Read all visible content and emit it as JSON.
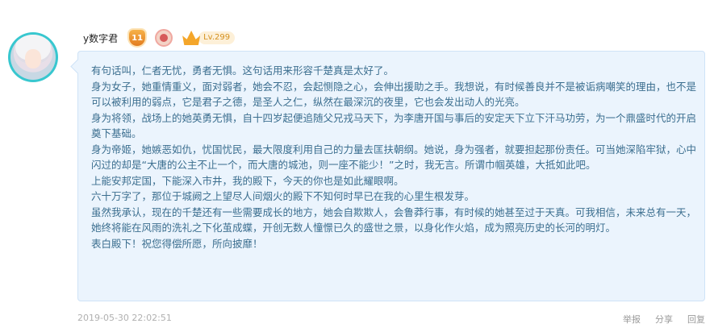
{
  "comment": {
    "username": "y数字君",
    "badges": {
      "shield_label": "11",
      "level": "Lv.299"
    },
    "paragraphs": [
      "有句话叫，仁者无忧，勇者无惧。这句话用来形容千楚真是太好了。",
      "身为女子，她重情重义，面对弱者，她会不忍，会起恻隐之心，会伸出援助之手。我想说，有时候善良并不是被诟病嘲笑的理由，也不是可以被利用的弱点，它是君子之德，是圣人之仁，纵然在最深沉的夜里，它也会发出动人的光亮。",
      "身为将领，战场上的她英勇无惧，自十四岁起便追随父兄戎马天下，为李唐开国与事后的安定天下立下汗马功劳，为一个鼎盛时代的开启奠下基础。",
      "身为帝姬，她嫉恶如仇，忧国忧民，最大限度利用自己的力量去匡扶朝纲。她说，身为强者，就要担起那份责任。可当她深陷牢狱，心中闪过的却是“大唐的公主不止一个，而大唐的城池，则一座不能少！”之时，我无言。所谓巾帼英雄，大抵如此吧。",
      "上能安邦定国，下能深入市井，我的殿下，今天的你也是如此耀眼啊。",
      "六十万字了，那位于城阙之上望尽人间烟火的殿下不知何时早已在我的心里生根发芽。",
      "虽然我承认，现在的千楚还有一些需要成长的地方，她会自欺欺人，会鲁莽行事，有时候的她甚至过于天真。可我相信，未来总有一天，她终将能在风雨的洗礼之下化茧成蝶，开创无数人憧憬已久的盛世之景，以身化作火焰，成为照亮历史的长河的明灯。",
      "表白殿下！祝您得偿所愿，所向披靡！"
    ],
    "timestamp": "2019-05-30 22:02:51",
    "actions": {
      "report": "举报",
      "share": "分享",
      "reply": "回复"
    }
  },
  "colors": {
    "bubble_bg": "#ebf4fd",
    "text": "#3b6e8f",
    "avatar_ring": "#38c7cf",
    "level_accent": "#d4901e"
  }
}
